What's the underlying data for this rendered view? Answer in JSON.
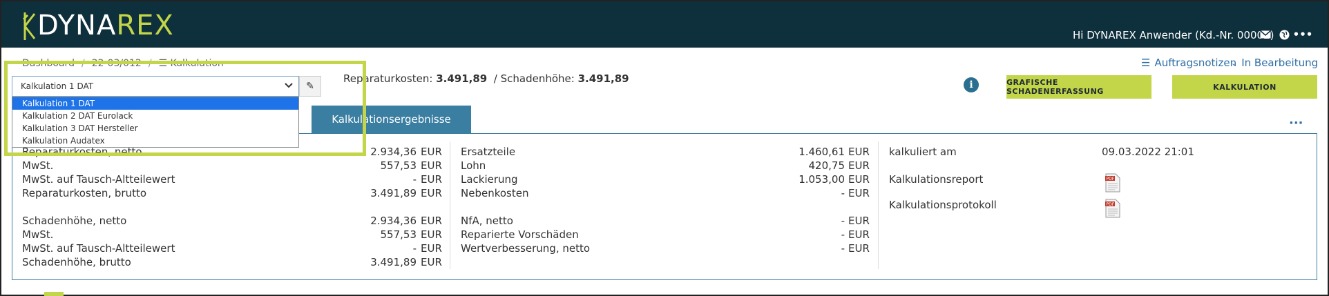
{
  "header": {
    "logo_left": "DYNA",
    "logo_right": "REX",
    "greeting": "Hi DYNAREX Anwender (Kd.-Nr. 00002)",
    "icons": [
      "envelope-icon",
      "globe-icon",
      "more-icon"
    ]
  },
  "breadcrumb": {
    "item1": "Dashboard",
    "item2": "22-03/012",
    "item3": "Kalkulation"
  },
  "top_links": {
    "notes": "Auftragsnotizen",
    "status": "In Bearbeitung"
  },
  "select": {
    "value": "Kalkulation 1 DAT",
    "options": [
      "Kalkulation 1 DAT",
      "Kalkulation 2 DAT Eurolack",
      "Kalkulation 3 DAT Hersteller",
      "Kalkulation Audatex"
    ]
  },
  "summary": {
    "repair_label": "Reparaturkosten:",
    "repair_value": "3.491,89",
    "damage_label": "/ Schadenhöhe:",
    "damage_value": "3.491,89"
  },
  "buttons": {
    "grafische": "GRAFISCHE SCHADENERFASSUNG",
    "kalkulation": "KALKULATION"
  },
  "tab": {
    "active": "Kalkulationsergebnisse"
  },
  "currency": "EUR",
  "col1": [
    {
      "label": "Reparaturkosten, netto",
      "value": "2.934,36"
    },
    {
      "label": "MwSt.",
      "value": "557,53"
    },
    {
      "label": "MwSt. auf Tausch-Altteilewert",
      "value": "-"
    },
    {
      "label": "Reparaturkosten, brutto",
      "value": "3.491,89"
    },
    {
      "label": "Schadenhöhe, netto",
      "value": "2.934,36"
    },
    {
      "label": "MwSt.",
      "value": "557,53"
    },
    {
      "label": "MwSt. auf Tausch-Altteilewert",
      "value": "-"
    },
    {
      "label": "Schadenhöhe, brutto",
      "value": "3.491,89"
    }
  ],
  "col2": [
    {
      "label": "Ersatzteile",
      "value": "1.460,61"
    },
    {
      "label": "Lohn",
      "value": "420,75"
    },
    {
      "label": "Lackierung",
      "value": "1.053,00"
    },
    {
      "label": "Nebenkosten",
      "value": "-"
    },
    {
      "label": "NfA, netto",
      "value": "-"
    },
    {
      "label": "Reparierte Vorschäden",
      "value": "-"
    },
    {
      "label": "Wertverbesserung, netto",
      "value": "-"
    }
  ],
  "col3": {
    "calc_label": "kalkuliert am",
    "calc_value": "09.03.2022 21:01",
    "report_label": "Kalkulationsreport",
    "protocol_label": "Kalkulationsprotokoll"
  },
  "colors": {
    "header_bg": "#0e2f3c",
    "accent": "#c3d548",
    "link": "#2e6ea6",
    "tab": "#3a7ea1"
  }
}
